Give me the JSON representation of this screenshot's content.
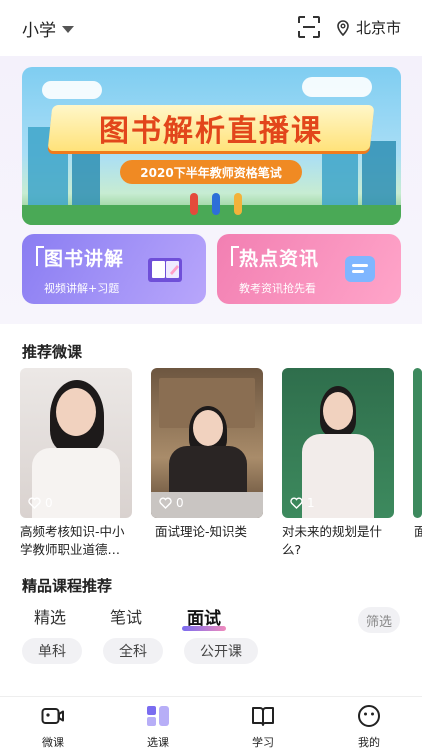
{
  "header": {
    "grade": "小学",
    "location": "北京市",
    "icons": {
      "scan": "scan-icon",
      "location": "location-pin-icon",
      "dropdown": "caret-down-icon"
    }
  },
  "banner": {
    "title": "图书解析直播课",
    "subtitle": "2020下半年教师资格笔试"
  },
  "feature_cards": [
    {
      "title": "图书讲解",
      "subtitle": "视频讲解+习题",
      "icon": "book-icon",
      "color": "#8a7df2"
    },
    {
      "title": "热点资讯",
      "subtitle": "教考资讯抢先看",
      "icon": "message-icon",
      "color": "#f27fb2"
    }
  ],
  "recommended": {
    "title": "推荐微课",
    "videos": [
      {
        "likes": "0",
        "title": "高频考核知识-中小学教师职业道德…"
      },
      {
        "likes": "0",
        "title": "面试理论-知识类"
      },
      {
        "likes": "1",
        "title": "对未来的规划是什么?"
      },
      {
        "likes": "",
        "title": "面"
      }
    ]
  },
  "premium": {
    "title": "精品课程推荐",
    "tabs": [
      "精选",
      "笔试",
      "面试"
    ],
    "active_tab": "面试",
    "filter": "筛选",
    "chips": [
      "单科",
      "全科",
      "公开课"
    ]
  },
  "tabbar": [
    {
      "label": "微课",
      "icon": "video-icon"
    },
    {
      "label": "选课",
      "icon": "grid-icon",
      "active": true
    },
    {
      "label": "学习",
      "icon": "book-open-icon"
    },
    {
      "label": "我的",
      "icon": "smiley-icon"
    }
  ],
  "colors": {
    "accent_purple": "#7a6cf0",
    "accent_pink": "#f08bbd",
    "banner_title": "#e2461b"
  }
}
